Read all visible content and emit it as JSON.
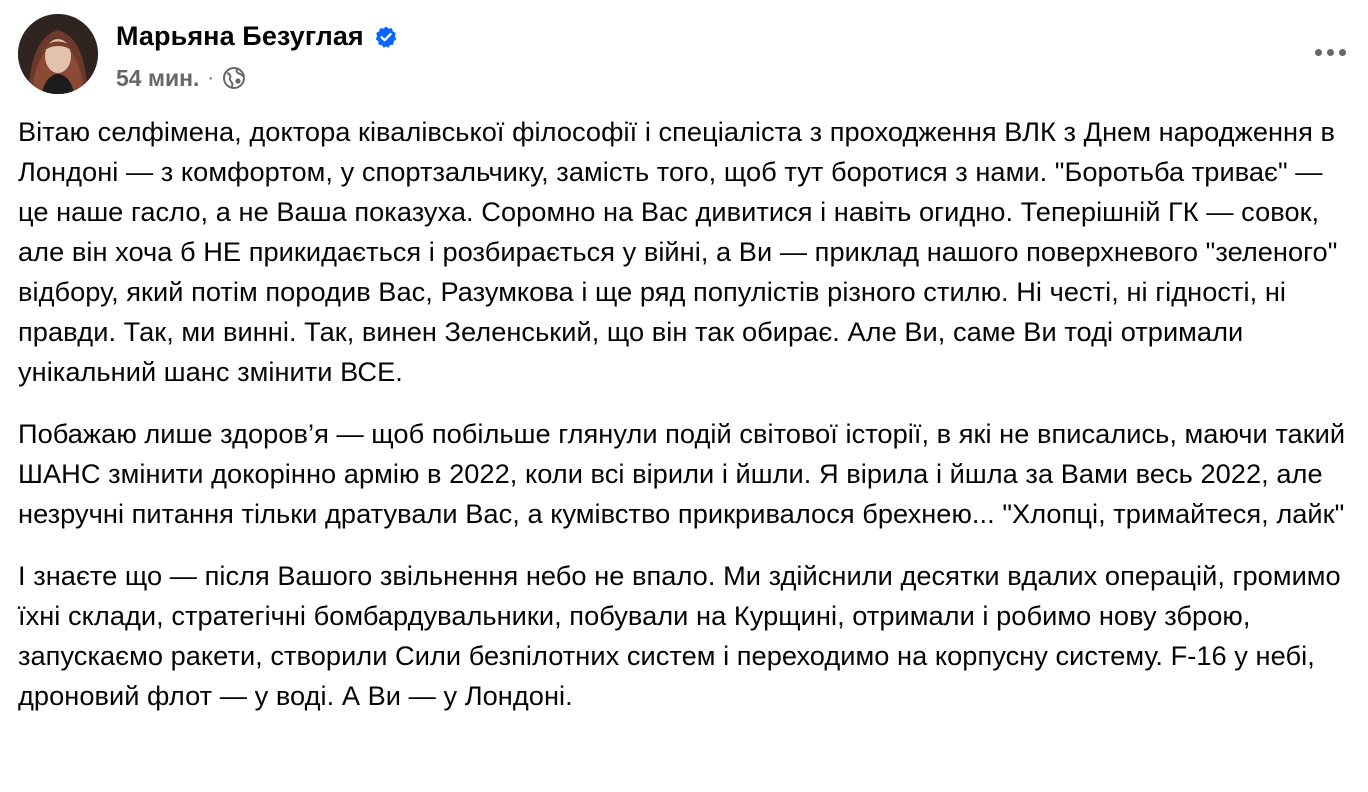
{
  "post": {
    "author": {
      "name": "Марьяна Безуглая",
      "verified": true,
      "avatar_icon": "person-avatar"
    },
    "time": "54 мин.",
    "separator": "·",
    "audience_icon": "globe-icon",
    "more_icon": "more-options-icon",
    "paragraphs": [
      "Вітаю селфімена, доктора ківалівської філософії і спеціаліста з проходження ВЛК з Днем народження в Лондоні — з комфортом, у спортзальчику, замість того, щоб тут боротися з нами. \"Боротьба триває\" — це наше гасло, а не Ваша показуха. Соромно на Вас дивитися і навіть огидно. Теперішній ГК — совок, але він хоча б НЕ прикидається і розбирається у війні, а Ви — приклад нашого поверхневого \"зеленого\" відбору, який потім породив Вас, Разумкова і ще ряд популістів різного стилю. Ні честі, ні гідності, ні правди. Так, ми винні. Так, винен Зеленський, що він так обирає. Але Ви, саме Ви тоді отримали унікальний шанс змінити ВСЕ.",
      "Побажаю лише здоров’я — щоб побільше глянули подій світової історії, в які не вписались, маючи такий ШАНС змінити докорінно армію в 2022, коли всі вірили і йшли. Я вірила і йшла за Вами весь 2022, але незручні питання тільки дратували Вас, а кумівство прикривалося брехнею... \"Хлопці, тримайтеся, лайк\"",
      "І знаєте що — після Вашого звільнення небо не впало. Ми здійснили десятки вдалих операцій, громимо їхні склади, стратегічні бомбардувальники, побували на Курщині, отримали і робимо нову зброю, запускаємо ракети, створили Сили безпілотних систем і переходимо на корпусну систему. F-16 у небі, дроновий флот — у воді. А Ви — у Лондоні."
    ]
  },
  "colors": {
    "text": "#050505",
    "secondary_text": "#65676b",
    "verified_badge": "#0866ff",
    "background": "#ffffff"
  }
}
